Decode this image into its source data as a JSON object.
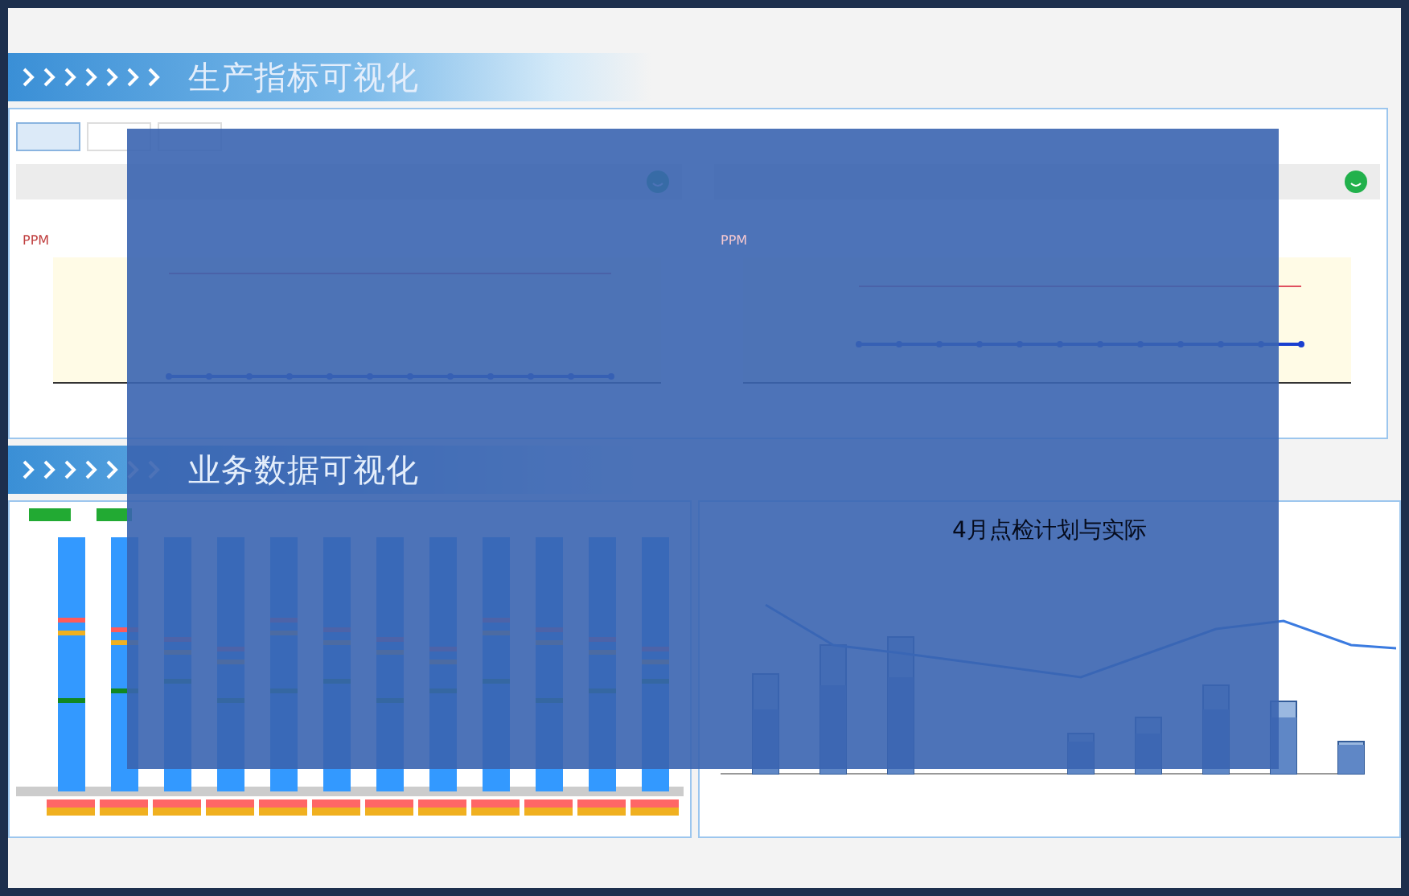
{
  "banners": [
    {
      "title": "生产指标可视化"
    },
    {
      "title": "业务数据可视化"
    }
  ],
  "tabs": [
    {
      "selected": true
    },
    {
      "selected": false
    },
    {
      "selected": false
    }
  ],
  "line_panels": [
    {
      "y_label": "PPM"
    },
    {
      "y_label": "PPM"
    }
  ],
  "inspection_chart": {
    "title": "4月点检计划与实际"
  }
}
